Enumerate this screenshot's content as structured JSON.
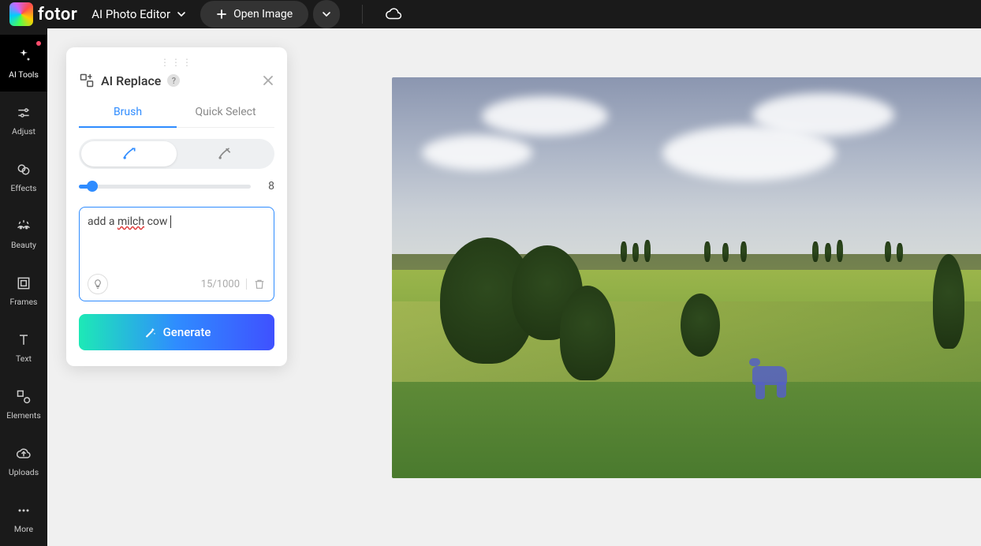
{
  "topbar": {
    "logo_text": "fotor",
    "dropdown_label": "AI Photo Editor",
    "open_image_label": "Open Image"
  },
  "sidebar": {
    "items": [
      {
        "label": "AI Tools"
      },
      {
        "label": "Adjust"
      },
      {
        "label": "Effects"
      },
      {
        "label": "Beauty"
      },
      {
        "label": "Frames"
      },
      {
        "label": "Text"
      },
      {
        "label": "Elements"
      },
      {
        "label": "Uploads"
      },
      {
        "label": "More"
      }
    ]
  },
  "panel": {
    "title": "AI Replace",
    "tabs": {
      "brush": "Brush",
      "quick_select": "Quick Select"
    },
    "slider_value": "8",
    "prompt_value_pre": "add a ",
    "prompt_value_err": "milch",
    "prompt_value_post": " cow",
    "char_count": "15/1000",
    "generate_label": "Generate"
  }
}
